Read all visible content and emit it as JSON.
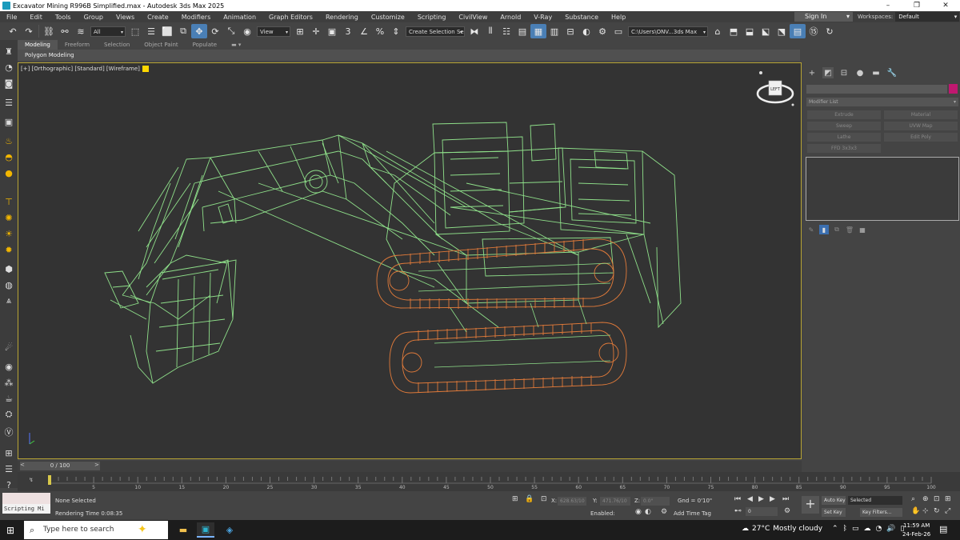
{
  "titlebar": {
    "title": "Excavator Mining R996B Simplified.max - Autodesk 3ds Max 2025",
    "minimize": "–",
    "maximize": "❐",
    "close": "✕"
  },
  "menubar": {
    "items": [
      "File",
      "Edit",
      "Tools",
      "Group",
      "Views",
      "Create",
      "Modifiers",
      "Animation",
      "Graph Editors",
      "Rendering",
      "Customize",
      "Scripting",
      "CivilView",
      "Arnold",
      "V-Ray",
      "Substance",
      "Help"
    ],
    "signin": "Sign In",
    "workspaces_label": "Workspaces:",
    "workspaces_value": "Default"
  },
  "toolbar": {
    "selection_filter": "All",
    "reference_coord": "View",
    "named_selection": "Create Selection Se",
    "project_path": "C:\\Users\\ONV...3ds Max 2025"
  },
  "ribbon": {
    "tabs": [
      "Modeling",
      "Freeform",
      "Selection",
      "Object Paint",
      "Populate"
    ],
    "active_tab": "Modeling",
    "sub_label": "Polygon Modeling"
  },
  "viewport": {
    "label": "[+] [Orthographic] [Standard] [Wireframe]",
    "viewcube_face": "LEFT",
    "wire_green": "#8fe08a",
    "wire_orange": "#e07a3a",
    "border_color": "#b9a534"
  },
  "command_panel": {
    "modifier_list": "Modifier List",
    "modifier_buttons": [
      "Extrude",
      "Material",
      "Sweep",
      "UVW Map",
      "Lathe",
      "Edit Poly",
      "FFD 3x3x3",
      ""
    ],
    "color_swatch": "#c01870"
  },
  "timeline": {
    "frame_display": "0 / 100",
    "ticks": [
      "0",
      "5",
      "10",
      "15",
      "20",
      "25",
      "30",
      "35",
      "40",
      "45",
      "50",
      "55",
      "60",
      "65",
      "70",
      "75",
      "80",
      "85",
      "90",
      "95",
      "100"
    ]
  },
  "status": {
    "script_label": "Scripting Mi",
    "selection": "None Selected",
    "render_time": "Rendering Time  0:08:35",
    "x_label": "X:",
    "x_value": "628.63/10",
    "y_label": "Y:",
    "y_value": "471.76/10",
    "z_label": "Z:",
    "z_value": "0.0\"",
    "grid": "Gnd = 0'10\"",
    "enabled": "Enabled:",
    "add_time_tag": "Add Time Tag",
    "auto_key": "Auto Key",
    "set_key": "Set Key",
    "key_selected": "Selected",
    "key_filters": "Key Filters...",
    "frame_value": "0"
  },
  "taskbar": {
    "search_placeholder": "Type here to search",
    "temperature": "27°C",
    "weather": "Mostly cloudy",
    "time": "11:59 AM",
    "date": "24-Feb-26",
    "notifications": "4"
  }
}
